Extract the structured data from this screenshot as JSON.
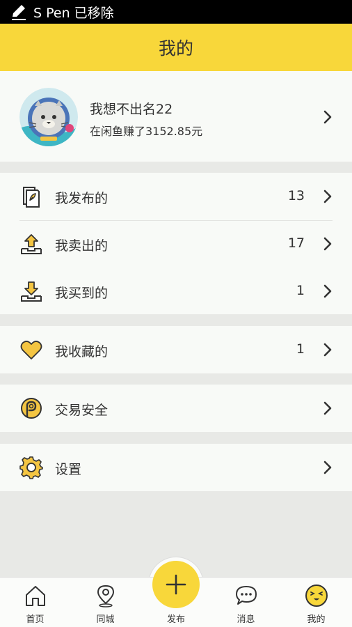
{
  "status_bar": {
    "text": "S Pen 已移除"
  },
  "header": {
    "title": "我的"
  },
  "profile": {
    "name": "我想不出名22",
    "subtitle": "在闲鱼赚了3152.85元"
  },
  "menu": {
    "published": {
      "label": "我发布的",
      "count": "13"
    },
    "sold": {
      "label": "我卖出的",
      "count": "17"
    },
    "bought": {
      "label": "我买到的",
      "count": "1"
    },
    "favorites": {
      "label": "我收藏的",
      "count": "1"
    },
    "security": {
      "label": "交易安全"
    },
    "settings": {
      "label": "设置"
    }
  },
  "tabbar": {
    "home": "首页",
    "nearby": "同城",
    "publish": "发布",
    "messages": "消息",
    "mine": "我的"
  },
  "colors": {
    "accent": "#f8d73a",
    "background": "#e8e9e6",
    "card": "#f8faf7",
    "text": "#333333"
  }
}
